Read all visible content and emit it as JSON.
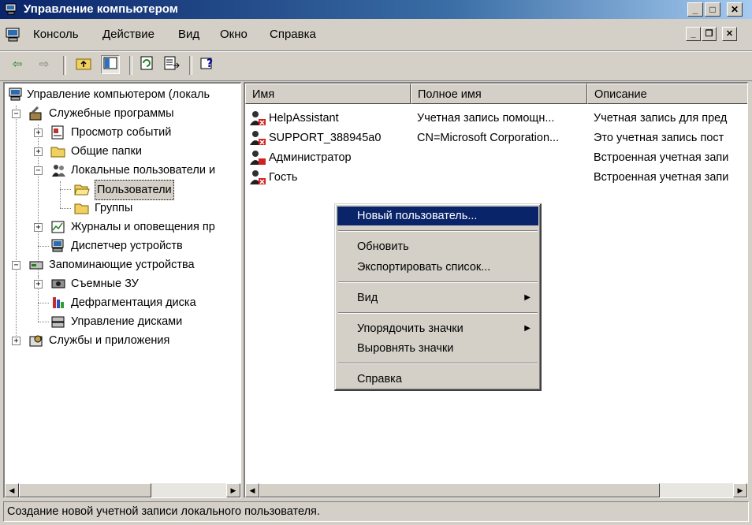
{
  "window": {
    "title": "Управление компьютером"
  },
  "menubar": {
    "items": [
      "Консоль",
      "Действие",
      "Вид",
      "Окно",
      "Справка"
    ]
  },
  "toolbar": {
    "buttons": [
      "back-icon",
      "forward-icon",
      "up-folder-icon",
      "show-hide-tree-icon",
      "refresh-icon",
      "export-list-icon",
      "help-icon"
    ]
  },
  "tree": {
    "items": [
      {
        "label": "Управление компьютером (локаль",
        "icon": "computer-icon"
      },
      {
        "label": "Служебные программы",
        "icon": "tools-icon"
      },
      {
        "label": "Просмотр событий",
        "icon": "event-viewer-icon"
      },
      {
        "label": "Общие папки",
        "icon": "shared-folder-icon"
      },
      {
        "label": "Локальные пользователи и",
        "icon": "users-groups-icon"
      },
      {
        "label": "Пользователи",
        "icon": "folder-open-icon"
      },
      {
        "label": "Группы",
        "icon": "folder-icon"
      },
      {
        "label": "Журналы и оповещения пр",
        "icon": "performance-logs-icon"
      },
      {
        "label": "Диспетчер устройств",
        "icon": "device-manager-icon"
      },
      {
        "label": "Запоминающие устройства",
        "icon": "storage-icon"
      },
      {
        "label": "Съемные ЗУ",
        "icon": "removable-storage-icon"
      },
      {
        "label": "Дефрагментация диска",
        "icon": "defrag-icon"
      },
      {
        "label": "Управление дисками",
        "icon": "disk-management-icon"
      },
      {
        "label": "Службы и приложения",
        "icon": "services-icon"
      }
    ]
  },
  "list": {
    "columns": [
      "Имя",
      "Полное имя",
      "Описание"
    ],
    "rows": [
      {
        "name": "HelpAssistant",
        "full_name": "Учетная запись помощн...",
        "description": "Учетная запись для пред"
      },
      {
        "name": "SUPPORT_388945a0",
        "full_name": "CN=Microsoft Corporation...",
        "description": "Это учетная запись пост"
      },
      {
        "name": "Администратор",
        "full_name": "",
        "description": "Встроенная учетная запи"
      },
      {
        "name": "Гость",
        "full_name": "",
        "description": "Встроенная учетная запи"
      }
    ]
  },
  "context_menu": {
    "items": [
      {
        "label": "Новый пользователь...",
        "highlighted": true,
        "submenu": false
      },
      {
        "label": "Обновить",
        "highlighted": false,
        "submenu": false
      },
      {
        "label": "Экспортировать список...",
        "highlighted": false,
        "submenu": false
      },
      {
        "label": "Вид",
        "highlighted": false,
        "submenu": true
      },
      {
        "label": "Упорядочить значки",
        "highlighted": false,
        "submenu": true
      },
      {
        "label": "Выровнять значки",
        "highlighted": false,
        "submenu": false
      },
      {
        "label": "Справка",
        "highlighted": false,
        "submenu": false
      }
    ]
  },
  "status": {
    "text": "Создание новой учетной записи локального пользователя."
  },
  "colors": {
    "selection": "#0a246a",
    "face": "#d4d0c8",
    "title_start": "#0a246a",
    "title_end": "#a6caf0"
  }
}
